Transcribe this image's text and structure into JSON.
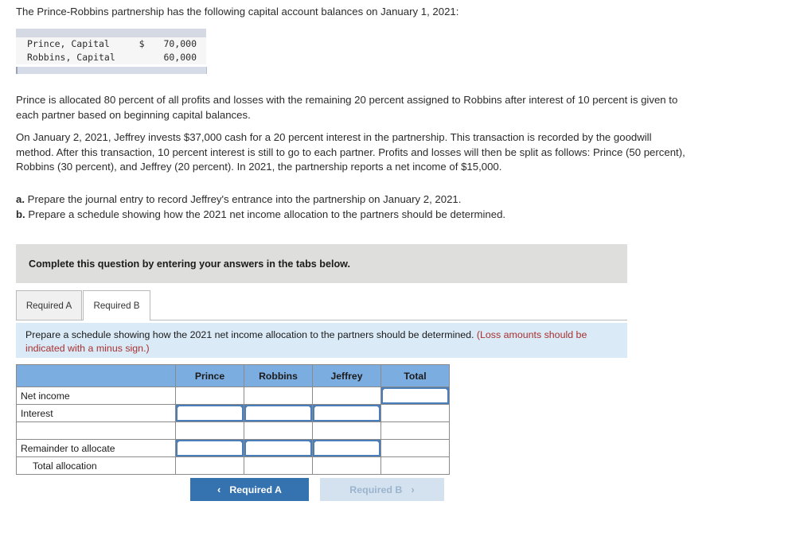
{
  "intro": {
    "text": "The Prince-Robbins partnership has the following capital account balances on January 1, 2021:"
  },
  "capital_table": {
    "rows": [
      {
        "label": "Prince, Capital",
        "currency": "$",
        "amount": "70,000"
      },
      {
        "label": "Robbins, Capital",
        "currency": "",
        "amount": "60,000"
      }
    ]
  },
  "paragraphs": {
    "p1": "Prince is allocated 80 percent of all profits and losses with the remaining 20 percent assigned to Robbins after interest of 10 percent is given to each partner based on beginning capital balances.",
    "p2": "On January 2, 2021, Jeffrey invests $37,000 cash for a 20 percent interest in the partnership. This transaction is recorded by the goodwill method. After this transaction, 10 percent interest is still to go to each partner. Profits and losses will then be split as follows: Prince (50 percent), Robbins (30 percent), and Jeffrey (20 percent). In 2021, the partnership reports a net income of $15,000."
  },
  "requirements": [
    {
      "key": "a.",
      "text": "Prepare the journal entry to record Jeffrey's entrance into the partnership on January 2, 2021."
    },
    {
      "key": "b.",
      "text": "Prepare a schedule showing how the 2021 net income allocation to the partners should be determined."
    }
  ],
  "banner": {
    "text": "Complete this question by entering your answers in the tabs below."
  },
  "tabs": [
    {
      "label": "Required A",
      "active": false
    },
    {
      "label": "Required B",
      "active": true
    }
  ],
  "instruction": {
    "main": "Prepare a schedule showing how the 2021 net income allocation to the partners should be determined. ",
    "warning": "(Loss amounts should be indicated with a minus sign.)"
  },
  "answer_table": {
    "headers": [
      "",
      "Prince",
      "Robbins",
      "Jeffrey",
      "Total"
    ],
    "rows": [
      {
        "label": "Net income",
        "indent": false,
        "cells": [
          "",
          "",
          "",
          ""
        ],
        "inputs": [
          false,
          false,
          false,
          true
        ]
      },
      {
        "label": "Interest",
        "indent": false,
        "cells": [
          "",
          "",
          "",
          ""
        ],
        "inputs": [
          true,
          true,
          true,
          false
        ]
      },
      {
        "label": "",
        "indent": false,
        "cells": [
          "",
          "",
          "",
          ""
        ],
        "inputs": [
          false,
          false,
          false,
          false
        ]
      },
      {
        "label": "Remainder to allocate",
        "indent": false,
        "cells": [
          "",
          "",
          "",
          ""
        ],
        "inputs": [
          true,
          true,
          true,
          false
        ]
      },
      {
        "label": "Total allocation",
        "indent": true,
        "cells": [
          "",
          "",
          "",
          ""
        ],
        "inputs": [
          false,
          false,
          false,
          false
        ]
      }
    ]
  },
  "nav": {
    "prev_label": "Required A",
    "next_label": "Required B",
    "prev_chevron": "‹",
    "next_chevron": "›"
  },
  "colors": {
    "header_blue": "#7CADE0",
    "input_border": "#4A7EBB",
    "banner_gray": "#DEDEDD",
    "instruction_blue": "#DAEAF7",
    "warning_red": "#A8312F",
    "primary_button": "#3572B0",
    "disabled_button": "#D4E2F0"
  }
}
